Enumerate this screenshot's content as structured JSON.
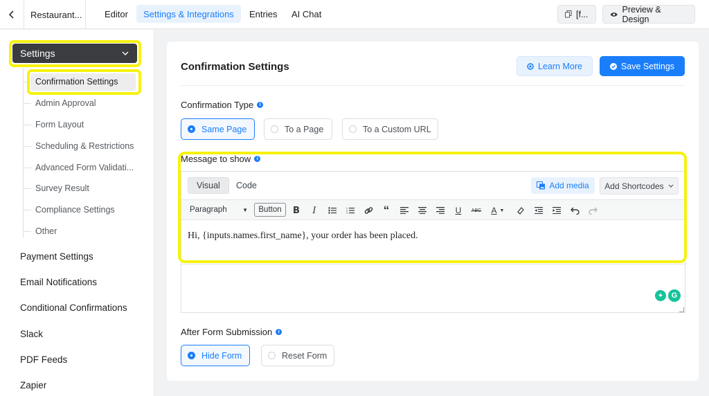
{
  "topbar": {
    "back_icon": "chevron-left-icon",
    "form_name": "Restaurant...",
    "tabs": [
      {
        "label": "Editor"
      },
      {
        "label": "Settings & Integrations",
        "active": true
      },
      {
        "label": "Entries"
      },
      {
        "label": "AI Chat"
      }
    ],
    "shortcode_button": "[f...",
    "preview_button": "Preview & Design"
  },
  "sidebar": {
    "settings_label": "Settings",
    "sub_items": [
      "Confirmation Settings",
      "Admin Approval",
      "Form Layout",
      "Scheduling & Restrictions",
      "Advanced Form Validati...",
      "Survey Result",
      "Compliance Settings",
      "Other"
    ],
    "main_items": [
      "Payment Settings",
      "Email Notifications",
      "Conditional Confirmations",
      "Slack",
      "PDF Feeds",
      "Zapier"
    ]
  },
  "main": {
    "title": "Confirmation Settings",
    "learn_more": "Learn More",
    "save_settings": "Save Settings",
    "confirmation_type": {
      "label": "Confirmation Type",
      "options": [
        "Same Page",
        "To a Page",
        "To a Custom URL"
      ],
      "selected": "Same Page"
    },
    "message": {
      "label": "Message to show",
      "tabs": [
        "Visual",
        "Code"
      ],
      "add_media": "Add media",
      "add_shortcodes": "Add Shortcodes",
      "format_select": "Paragraph",
      "button_tag": "Button",
      "content": "Hi, {inputs.names.first_name}, your order has been placed."
    },
    "after_submission": {
      "label": "After Form Submission",
      "options": [
        "Hide Form",
        "Reset Form"
      ],
      "selected": "Hide Form"
    }
  },
  "colors": {
    "accent": "#1a7efb",
    "highlight": "#f6f20e",
    "settings_header": "#3a3c40"
  }
}
